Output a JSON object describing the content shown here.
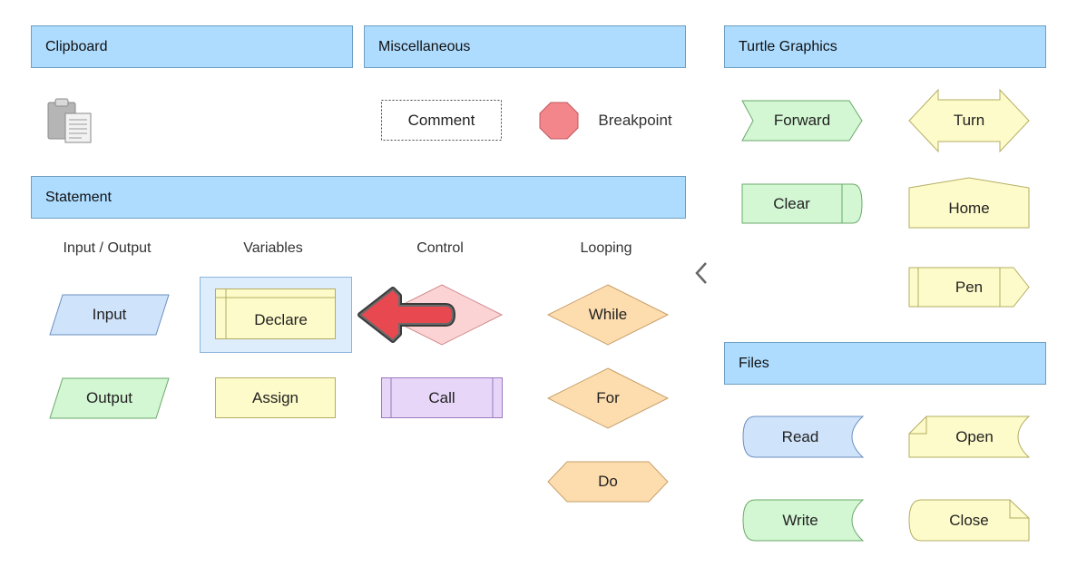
{
  "panels": {
    "clipboard": {
      "title": "Clipboard"
    },
    "misc": {
      "title": "Miscellaneous",
      "comment": "Comment",
      "breakpoint": "Breakpoint"
    },
    "statement": {
      "title": "Statement",
      "columns": {
        "io": "Input / Output",
        "variables": "Variables",
        "control": "Control",
        "looping": "Looping"
      },
      "input": "Input",
      "output": "Output",
      "declare": "Declare",
      "assign": "Assign",
      "call": "Call",
      "while": "While",
      "for": "For",
      "do": "Do"
    },
    "turtle": {
      "title": "Turtle Graphics",
      "forward": "Forward",
      "turn": "Turn",
      "clear": "Clear",
      "home": "Home",
      "pen": "Pen"
    },
    "files": {
      "title": "Files",
      "read": "Read",
      "open": "Open",
      "write": "Write",
      "close": "Close"
    }
  },
  "icons": {
    "clipboard": "clipboard-icon",
    "collapse": "chevron-left-icon",
    "pointer": "red-arrow-pointer"
  },
  "colors": {
    "header_bg": "#aedcff",
    "io_fill": "#cfe3fb",
    "output_fill": "#d3f6d3",
    "variable_fill": "#fdfbc9",
    "call_fill": "#e7d6f8",
    "control_fill": "#fbd3d4",
    "loop_fill": "#fddcae",
    "breakpoint_fill": "#f3868b",
    "arrow_fill": "#e8484f"
  }
}
